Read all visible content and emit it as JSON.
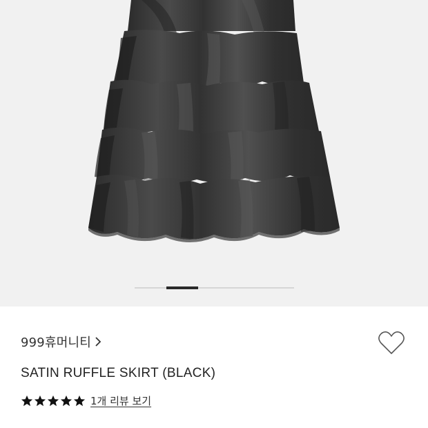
{
  "product": {
    "brand": "999휴머니티",
    "title": "SATIN RUFFLE SKIRT (BLACK)",
    "rating": 5,
    "rating_max": 5,
    "review_link": "1개 리뷰 보기"
  },
  "gallery": {
    "image_subject": "black satin tiered ruffle skirt",
    "current_index": 2,
    "total": 5
  },
  "icons": {
    "brand_chevron": "chevron-right-icon",
    "wishlist": "heart-outline-icon",
    "rating": "star-icon"
  },
  "colors": {
    "gallery_bg": "#f1f1f1",
    "skirt": "#3a3a3a",
    "star": "#111111",
    "text": "#222222"
  }
}
